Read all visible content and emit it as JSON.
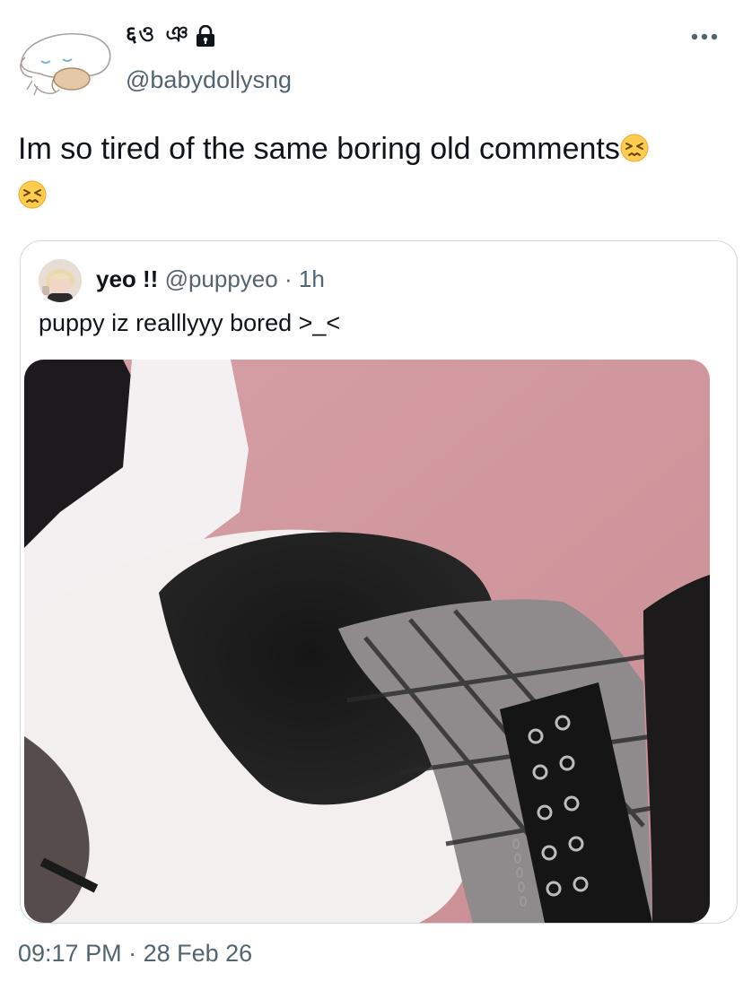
{
  "tweet": {
    "author": {
      "display_name": "६ও ঞ",
      "handle": "@babydollysng",
      "protected_icon": "lock-icon",
      "avatar_icon": "sleepy-dog-avatar"
    },
    "more_icon": "more-horizontal-icon",
    "text": "Im so tired of the same boring old comments",
    "emoji": "persevering-face-emoji",
    "timestamp": "09:17 PM",
    "separator": "·",
    "date": "28 Feb 26"
  },
  "quoted_tweet": {
    "display_name": "yeo !!",
    "handle": "@puppyeo",
    "separator": "·",
    "time_ago": "1h",
    "text": "puppy iz realllyyy bored >_<",
    "media": {
      "type": "photo",
      "background_color": "#d49ea2"
    }
  },
  "colors": {
    "text_primary": "#0f1419",
    "text_secondary": "#536471",
    "border": "#cfd9de"
  }
}
